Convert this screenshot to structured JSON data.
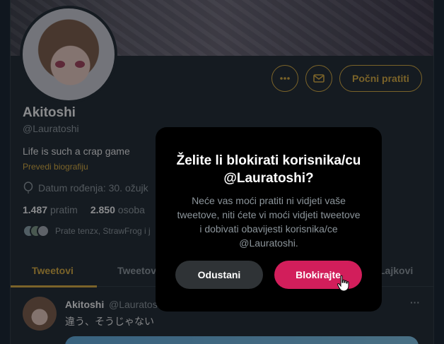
{
  "profile": {
    "name": "Akitoshi",
    "handle": "@Lauratoshi",
    "bio": "Life is such a crap game",
    "translate_bio": "Prevedi biografiju",
    "birth_date": "Datum rođenja: 30. ožujk",
    "following_count": "1.487",
    "following_label": "pratim",
    "followers_count": "2.850",
    "followers_label": "osoba",
    "followed_by": "Prate tenzx, StrawFrog i j"
  },
  "actions": {
    "follow_label": "Počni pratiti",
    "more_icon": "more-icon",
    "mail_icon": "mail-icon"
  },
  "tabs": [
    {
      "label": "Tweetovi",
      "active": true
    },
    {
      "label": "Tweetov",
      "active": false
    },
    {
      "label": "Lajkovi",
      "active": false
    }
  ],
  "tweet": {
    "name": "Akitoshi",
    "handle": "@Lauratos",
    "text": "違う、そうじゃない",
    "more": "···"
  },
  "modal": {
    "title": "Želite li blokirati korisnika/cu @Lauratoshi?",
    "body": "Neće vas moći pratiti ni vidjeti vaše tweetove, niti ćete vi moći vidjeti tweetove i dobivati obavijesti korisnika/ce @Lauratoshi.",
    "cancel_label": "Odustani",
    "block_label": "Blokirajte"
  },
  "colors": {
    "accent": "#d6a93c",
    "danger": "#d21e5b",
    "background": "#1e272e"
  }
}
